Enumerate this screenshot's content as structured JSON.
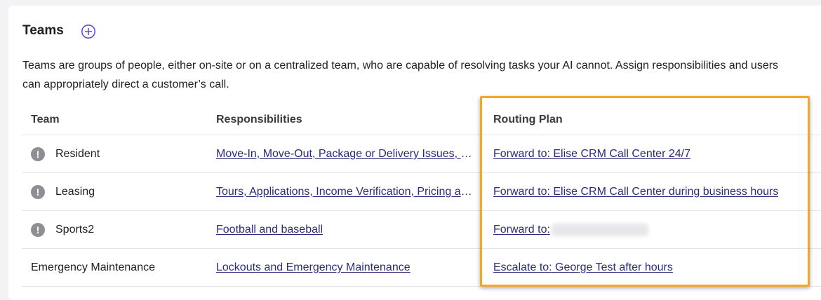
{
  "panel": {
    "title": "Teams",
    "add_icon": "plus-circle-icon",
    "description_line1": "Teams are groups of people, either on-site or on a centralized team, who are capable of resolving tasks your AI cannot. Assign responsibilities and users",
    "description_line2": "can appropriately direct a customer’s call."
  },
  "table": {
    "columns": [
      "Team",
      "Responsibilities",
      "Routing Plan"
    ],
    "rows": [
      {
        "team": "Resident",
        "warning": true,
        "responsibilities": "Move-In, Move-Out, Package or Delivery Issues, Maintenance",
        "routing_plan": "Forward to: Elise CRM Call Center 24/7"
      },
      {
        "team": "Leasing",
        "warning": true,
        "responsibilities": "Tours, Applications, Income Verification, Pricing and Availability",
        "routing_plan": "Forward to: Elise CRM Call Center during business hours"
      },
      {
        "team": "Sports2",
        "warning": true,
        "responsibilities": "Football and baseball",
        "routing_plan": "Forward to:"
      },
      {
        "team": "Emergency Maintenance",
        "warning": false,
        "responsibilities": "Lockouts and Emergency Maintenance",
        "routing_plan": "Escalate to: George Test after hours"
      }
    ]
  },
  "colors": {
    "link": "#2b2a7c",
    "accent": "#5b4fd6",
    "highlight": "#f2a72a",
    "warning_icon": "#8e8e93"
  },
  "icons": {
    "warning": "exclamation-circle-icon",
    "warning_glyph": "!"
  }
}
